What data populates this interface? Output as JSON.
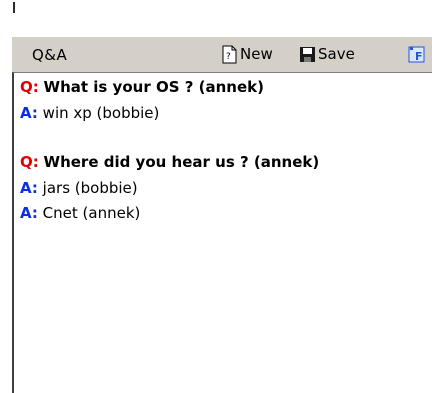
{
  "panel": {
    "title": "Q&A"
  },
  "toolbar": {
    "new_label": "New",
    "save_label": "Save",
    "new_icon": "new-document-icon",
    "save_icon": "floppy-disk-icon",
    "extra_icon": "format-icon"
  },
  "colors": {
    "question_prefix": "#e00000",
    "answer_prefix": "#0a2ee0",
    "toolbar_bg": "#d4d0c8"
  },
  "threads": [
    {
      "question": {
        "prefix": "Q:",
        "text": "What is your OS ? (annek)"
      },
      "answers": [
        {
          "prefix": "A:",
          "text": "win xp (bobbie)"
        }
      ]
    },
    {
      "question": {
        "prefix": "Q:",
        "text": "Where did you hear us ? (annek)"
      },
      "answers": [
        {
          "prefix": "A:",
          "text": "jars (bobbie)"
        },
        {
          "prefix": "A:",
          "text": "Cnet (annek)"
        }
      ]
    }
  ]
}
